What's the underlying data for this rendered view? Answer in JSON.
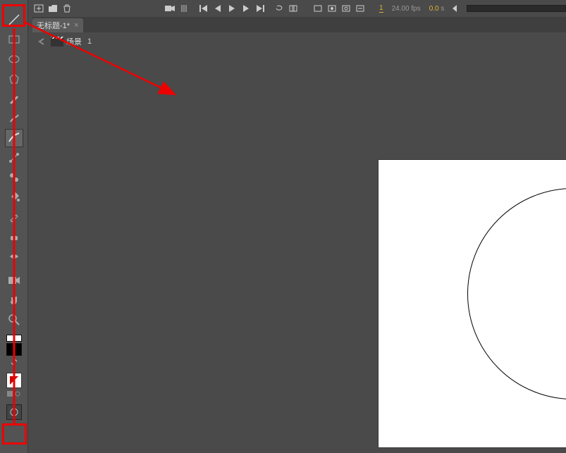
{
  "timeline": {
    "frame": "1",
    "fps": "24.00",
    "fps_unit": "fps",
    "time": "0.0",
    "time_unit": "s"
  },
  "tab": {
    "title": "无标题-1*",
    "close": "×"
  },
  "scene": {
    "label": "场景",
    "number": "1"
  },
  "iconnames": {
    "line": "line-tool",
    "rect": "rectangle-tool"
  },
  "annotations": {
    "r1": "line-tool-highlight",
    "r2": "object-drawing-highlight"
  }
}
